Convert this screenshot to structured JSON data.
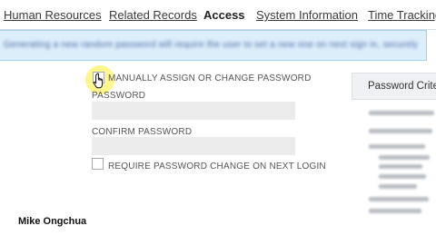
{
  "tabs": [
    {
      "label": "Human Resources",
      "active": false
    },
    {
      "label": "Related Records",
      "active": false
    },
    {
      "label": "Access",
      "active": true
    },
    {
      "label": "System Information",
      "active": false
    },
    {
      "label": "Time Tracking",
      "active": false
    }
  ],
  "banner": {
    "text": "Generating a new random password will require the user to set a new one on next sign in, securely",
    "obscured": true
  },
  "form": {
    "manual_assign_label": "MANUALLY ASSIGN OR CHANGE PASSWORD",
    "manual_assign_checked": false,
    "password_label": "PASSWORD",
    "password_value": "",
    "confirm_label": "CONFIRM PASSWORD",
    "confirm_value": "",
    "require_change_label": "REQUIRE PASSWORD CHANGE ON NEXT LOGIN",
    "require_change_checked": false
  },
  "criteria_panel": {
    "title": "Password Crite",
    "body_obscured": true
  },
  "user_name": "Mike Ongchua",
  "colors": {
    "banner_bg": "#ddeefb",
    "banner_border": "#9fd0f4",
    "field_bg": "#ececec",
    "cursor_highlight": "#fff350"
  },
  "icons": {
    "cursor": "hand-pointer-icon"
  }
}
